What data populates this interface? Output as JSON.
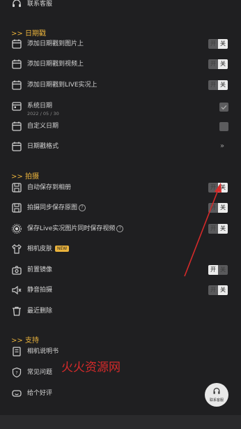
{
  "top_item": {
    "label": "联系客服"
  },
  "sections": {
    "date": "日期戳",
    "shoot": "拍摄",
    "support": "支持"
  },
  "section_marker": ">>",
  "date_items": [
    {
      "label": "添加日期戳到图片上",
      "toggle": "off"
    },
    {
      "label": "添加日期戳到视频上",
      "toggle": "off"
    },
    {
      "label": "添加日期戳到LIVE实况上",
      "toggle": "off"
    },
    {
      "label": "系统日期",
      "sub": "2022 / 05 / 30",
      "checked": true
    },
    {
      "label": "自定义日期",
      "checked": false
    },
    {
      "label": "日期戳格式",
      "chevron": "»"
    }
  ],
  "shoot_items": [
    {
      "label": "自动保存到相册",
      "toggle": "off"
    },
    {
      "label": "拍摄同步保存原图",
      "help": "?",
      "toggle": "off"
    },
    {
      "label": "保存Live实况图片同时保存视频",
      "help": "?",
      "toggle": "off"
    },
    {
      "label": "相机皮肤",
      "badge": "NEW"
    },
    {
      "label": "前置镜像",
      "toggle": "on"
    },
    {
      "label": "静音拍摄",
      "toggle": "off"
    },
    {
      "label": "最近删除"
    }
  ],
  "support_items": [
    {
      "label": "相机说明书"
    },
    {
      "label": "常见问题"
    },
    {
      "label": "给个好评"
    }
  ],
  "toggle_text": {
    "on": "开",
    "off": "关"
  },
  "watermark": "火火资源网",
  "fab": {
    "label": "联系客服"
  },
  "colors": {
    "background": "#1f1f21",
    "accent": "#e9b23c",
    "annotation": "#d62a2a"
  }
}
